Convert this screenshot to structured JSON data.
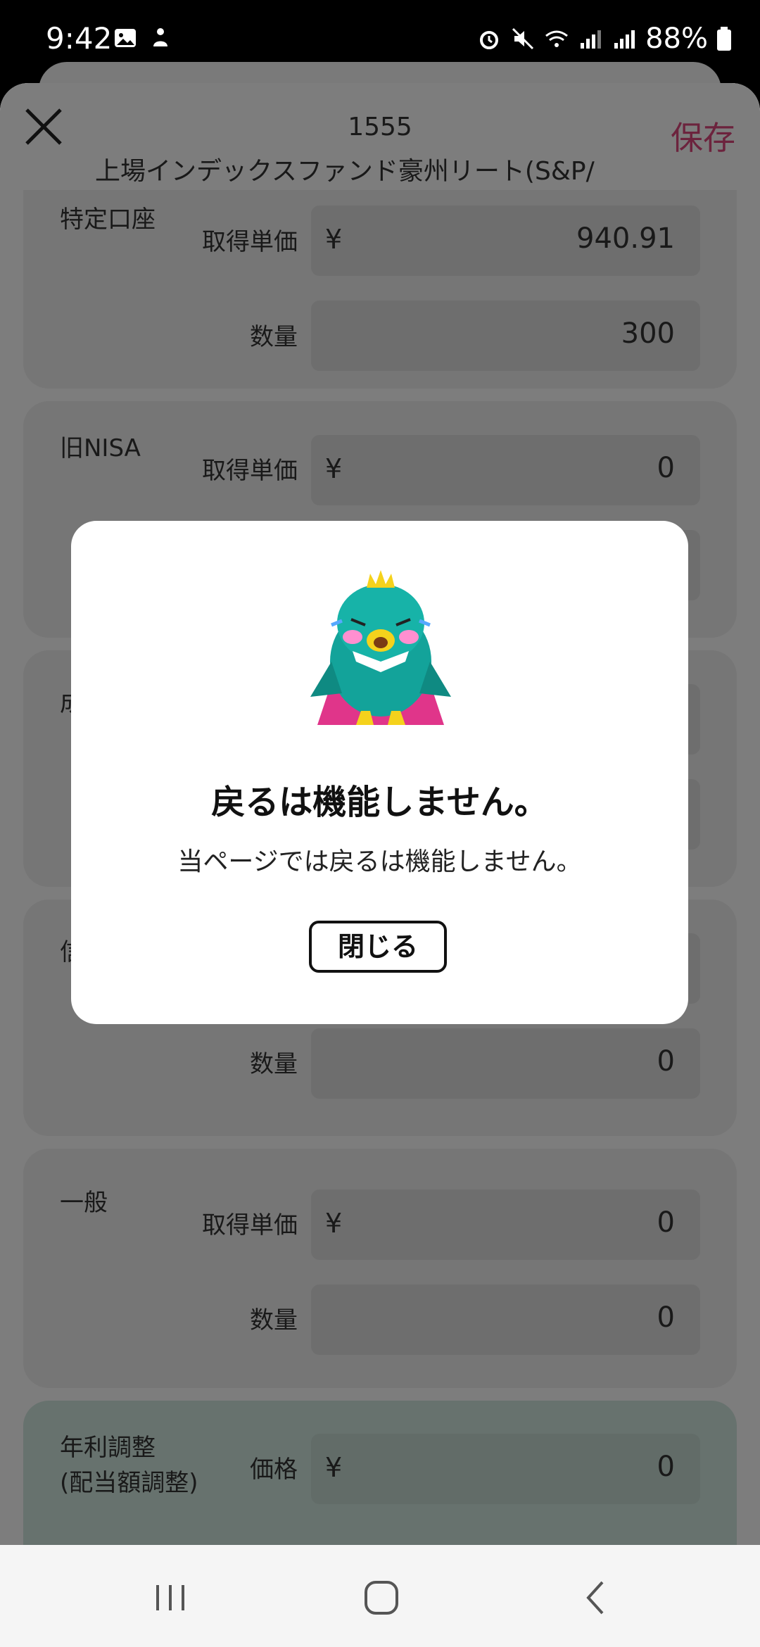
{
  "status_bar": {
    "time": "9:42",
    "battery": "88%",
    "icons_left": [
      "image-icon",
      "accessibility-icon"
    ],
    "icons_right": [
      "alarm-icon",
      "mute-icon",
      "wifi-icon",
      "signal-icon",
      "signal-icon",
      "battery-icon"
    ]
  },
  "header": {
    "code": "1555",
    "name": "上場インデックスファンド豪州リート(S&P/",
    "save_label": "保存",
    "accent_color": "#d9467a"
  },
  "accounts": [
    {
      "title": "特定口座",
      "price_label": "取得単価",
      "currency": "¥",
      "price": "940.91",
      "qty_label": "数量",
      "qty": "300"
    },
    {
      "title": "旧NISA",
      "price_label": "取得単価",
      "currency": "¥",
      "price": "0"
    },
    {
      "title": "成"
    },
    {
      "title": "信",
      "qty_label": "数量",
      "qty": "0"
    },
    {
      "title": "一般",
      "price_label": "取得単価",
      "currency": "¥",
      "price": "0",
      "qty_label": "数量",
      "qty": "0"
    }
  ],
  "adjustment": {
    "title_line1": "年利調整",
    "title_line2": "(配当額調整)",
    "price_label": "価格",
    "currency": "¥",
    "price": "0"
  },
  "dialog": {
    "title": "戻るは機能しません。",
    "message": "当ページでは戻るは機能しません。",
    "close_label": "閉じる"
  },
  "nav": {
    "items": [
      "recent-apps-icon",
      "home-icon",
      "back-icon"
    ]
  }
}
